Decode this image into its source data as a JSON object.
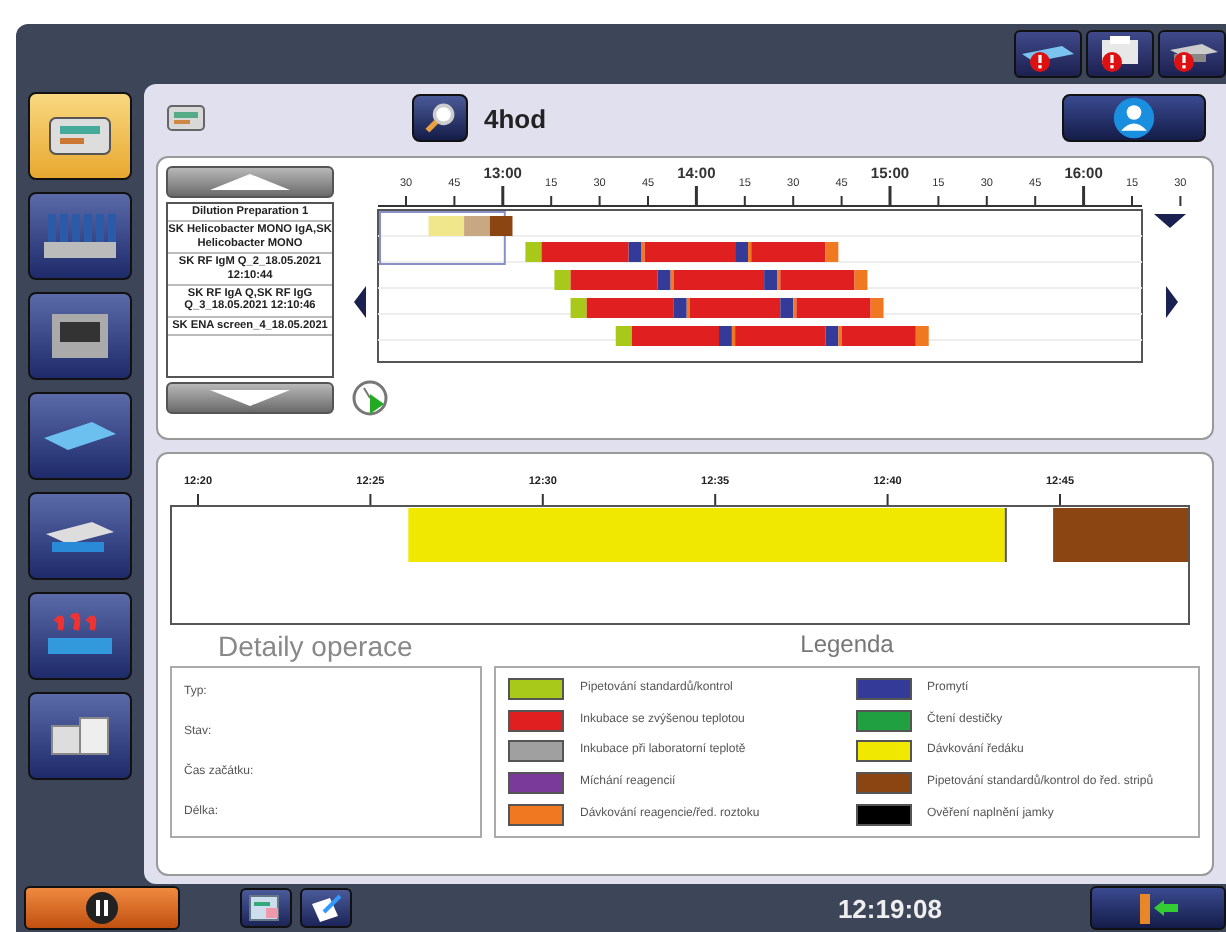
{
  "sidebar": {
    "items": [
      {
        "selected": true
      },
      {
        "selected": false
      },
      {
        "selected": false
      },
      {
        "selected": false
      },
      {
        "selected": false
      },
      {
        "selected": false
      },
      {
        "selected": false
      }
    ]
  },
  "toolbar": {
    "range": "4hod"
  },
  "task_list": [
    "Dilution Preparation 1",
    "SK Helicobacter MONO IgA,SK Helicobacter MONO",
    "SK RF IgM Q_2_18.05.2021 12:10:44",
    "SK RF IgA Q,SK RF IgG Q_3_18.05.2021 12:10:46",
    "SK ENA screen_4_18.05.2021"
  ],
  "timeline": {
    "ticks": [
      {
        "label": "30",
        "kind": "minor"
      },
      {
        "label": "45",
        "kind": "minor"
      },
      {
        "label": "13:00",
        "kind": "major"
      },
      {
        "label": "15",
        "kind": "minor"
      },
      {
        "label": "30",
        "kind": "minor"
      },
      {
        "label": "45",
        "kind": "minor"
      },
      {
        "label": "14:00",
        "kind": "major"
      },
      {
        "label": "15",
        "kind": "minor"
      },
      {
        "label": "30",
        "kind": "minor"
      },
      {
        "label": "45",
        "kind": "minor"
      },
      {
        "label": "15:00",
        "kind": "major"
      },
      {
        "label": "15",
        "kind": "minor"
      },
      {
        "label": "30",
        "kind": "minor"
      },
      {
        "label": "45",
        "kind": "minor"
      },
      {
        "label": "16:00",
        "kind": "major"
      },
      {
        "label": "15",
        "kind": "minor"
      },
      {
        "label": "30",
        "kind": "minor"
      }
    ]
  },
  "detail_timeline": {
    "ticks": [
      "12:20",
      "12:25",
      "12:30",
      "12:35",
      "12:40",
      "12:45"
    ]
  },
  "details": {
    "title": "Detaily operace",
    "fields": [
      "Typ:",
      "Stav:",
      "Čas začátku:",
      "Délka:"
    ]
  },
  "legend": {
    "title": "Legenda",
    "items": [
      {
        "label": "Pipetování standardů/kontrol",
        "color": "#a8c81a"
      },
      {
        "label": "Inkubace se zvýšenou teplotou",
        "color": "#e02020"
      },
      {
        "label": "Inkubace při laboratorní teplotě",
        "color": "#a0a0a0"
      },
      {
        "label": "Míchání reagencií",
        "color": "#7a3a9a"
      },
      {
        "label": "Dávkování reagencie/řed. roztoku",
        "color": "#f07820"
      },
      {
        "label": "Promytí",
        "color": "#343a98"
      },
      {
        "label": "Čtení destičky",
        "color": "#20a040"
      },
      {
        "label": "Dávkování ředáku",
        "color": "#f0e800"
      },
      {
        "label": "Pipetování standardů/kontrol do řed. stripů",
        "color": "#8b4513"
      },
      {
        "label": "Ověření naplnění jamky",
        "color": "#000000"
      }
    ]
  },
  "status_bar": {
    "time": "12:19:08"
  }
}
